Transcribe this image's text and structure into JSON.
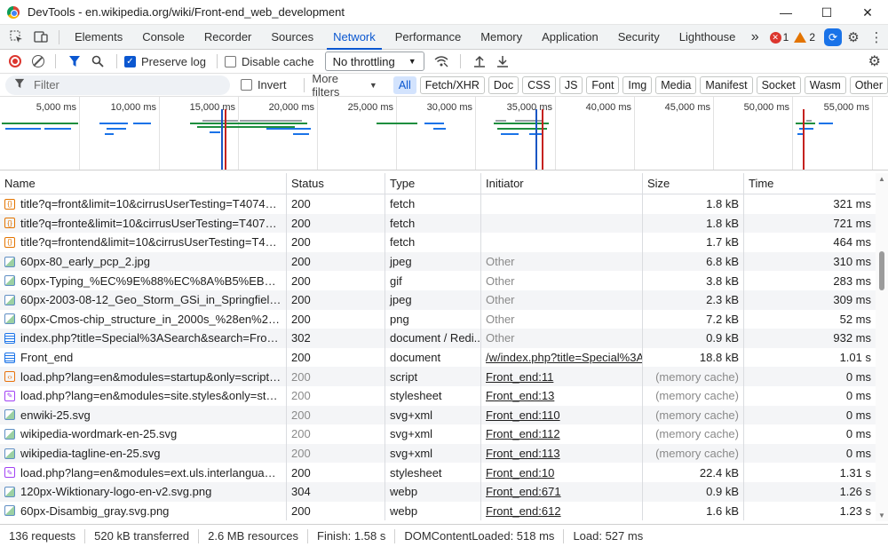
{
  "window": {
    "title": "DevTools - en.wikipedia.org/wiki/Front-end_web_development",
    "min": "—",
    "max": "☐",
    "close": "✕"
  },
  "tabs": [
    "Elements",
    "Console",
    "Recorder",
    "Sources",
    "Network",
    "Performance",
    "Memory",
    "Application",
    "Security",
    "Lighthouse"
  ],
  "active_tab": "Network",
  "more_tabs": "»",
  "errors_count": "1",
  "warnings_count": "2",
  "toolbar": {
    "preserve_log": "Preserve log",
    "disable_cache": "Disable cache",
    "throttling": "No throttling"
  },
  "filter": {
    "placeholder": "Filter",
    "invert": "Invert",
    "more_filters": "More filters",
    "types": [
      "All",
      "Fetch/XHR",
      "Doc",
      "CSS",
      "JS",
      "Font",
      "Img",
      "Media",
      "Manifest",
      "Socket",
      "Wasm",
      "Other"
    ]
  },
  "overview_ticks": [
    "5,000 ms",
    "10,000 ms",
    "15,000 ms",
    "20,000 ms",
    "25,000 ms",
    "30,000 ms",
    "35,000 ms",
    "40,000 ms",
    "45,000 ms",
    "50,000 ms",
    "55,000 ms"
  ],
  "columns": [
    "Name",
    "Status",
    "Type",
    "Initiator",
    "Size",
    "Time"
  ],
  "rows": [
    {
      "icon": "fetch",
      "name": "title?q=front&limit=10&cirrusUserTesting=T407432...",
      "status": "200",
      "type": "fetch",
      "initiator": "",
      "size": "1.8 kB",
      "time": "321 ms"
    },
    {
      "icon": "fetch",
      "name": "title?q=fronte&limit=10&cirrusUserTesting=T40743...",
      "status": "200",
      "type": "fetch",
      "initiator": "",
      "size": "1.8 kB",
      "time": "721 ms"
    },
    {
      "icon": "fetch",
      "name": "title?q=frontend&limit=10&cirrusUserTesting=T407...",
      "status": "200",
      "type": "fetch",
      "initiator": "",
      "size": "1.7 kB",
      "time": "464 ms"
    },
    {
      "icon": "img",
      "name": "60px-80_early_pcp_2.jpg",
      "status": "200",
      "type": "jpeg",
      "initiator": "Other",
      "size": "6.8 kB",
      "time": "310 ms"
    },
    {
      "icon": "img",
      "name": "60px-Typing_%EC%9E%88%EC%8A%B5%EB%8B%8...",
      "status": "200",
      "type": "gif",
      "initiator": "Other",
      "size": "3.8 kB",
      "time": "283 ms"
    },
    {
      "icon": "img",
      "name": "60px-2003-08-12_Geo_Storm_GSi_in_Springfield%2...",
      "status": "200",
      "type": "jpeg",
      "initiator": "Other",
      "size": "2.3 kB",
      "time": "309 ms"
    },
    {
      "icon": "img",
      "name": "60px-Cmos-chip_structure_in_2000s_%28en%29.svg....",
      "status": "200",
      "type": "png",
      "initiator": "Other",
      "size": "7.2 kB",
      "time": "52 ms"
    },
    {
      "icon": "doc",
      "name": "index.php?title=Special%3ASearch&search=Front+e...",
      "status": "302",
      "type": "document / Redi...",
      "initiator": "Other",
      "size": "0.9 kB",
      "time": "932 ms"
    },
    {
      "icon": "doc",
      "name": "Front_end",
      "status": "200",
      "type": "document",
      "initiator": "/w/index.php?title=Special%3ASe",
      "size": "18.8 kB",
      "time": "1.01 s"
    },
    {
      "icon": "script",
      "name": "load.php?lang=en&modules=startup&only=scripts...",
      "status": "200",
      "type": "script",
      "initiator": "Front_end:11",
      "size": "(memory cache)",
      "time": "0 ms"
    },
    {
      "icon": "css",
      "name": "load.php?lang=en&modules=site.styles&only=style...",
      "status": "200",
      "type": "stylesheet",
      "initiator": "Front_end:13",
      "size": "(memory cache)",
      "time": "0 ms"
    },
    {
      "icon": "img",
      "name": "enwiki-25.svg",
      "status": "200",
      "type": "svg+xml",
      "initiator": "Front_end:110",
      "size": "(memory cache)",
      "time": "0 ms"
    },
    {
      "icon": "img",
      "name": "wikipedia-wordmark-en-25.svg",
      "status": "200",
      "type": "svg+xml",
      "initiator": "Front_end:112",
      "size": "(memory cache)",
      "time": "0 ms"
    },
    {
      "icon": "img",
      "name": "wikipedia-tagline-en-25.svg",
      "status": "200",
      "type": "svg+xml",
      "initiator": "Front_end:113",
      "size": "(memory cache)",
      "time": "0 ms"
    },
    {
      "icon": "css",
      "name": "load.php?lang=en&modules=ext.uls.interlanguage...",
      "status": "200",
      "type": "stylesheet",
      "initiator": "Front_end:10",
      "size": "22.4 kB",
      "time": "1.31 s"
    },
    {
      "icon": "img",
      "name": "120px-Wiktionary-logo-en-v2.svg.png",
      "status": "304",
      "type": "webp",
      "initiator": "Front_end:671",
      "size": "0.9 kB",
      "time": "1.26 s"
    },
    {
      "icon": "img",
      "name": "60px-Disambig_gray.svg.png",
      "status": "200",
      "type": "webp",
      "initiator": "Front_end:612",
      "size": "1.6 kB",
      "time": "1.23 s"
    }
  ],
  "status": {
    "requests": "136 requests",
    "transferred": "520 kB transferred",
    "resources": "2.6 MB resources",
    "finish": "Finish: 1.58 s",
    "dcl": "DOMContentLoaded: 518 ms",
    "load": "Load: 527 ms"
  }
}
